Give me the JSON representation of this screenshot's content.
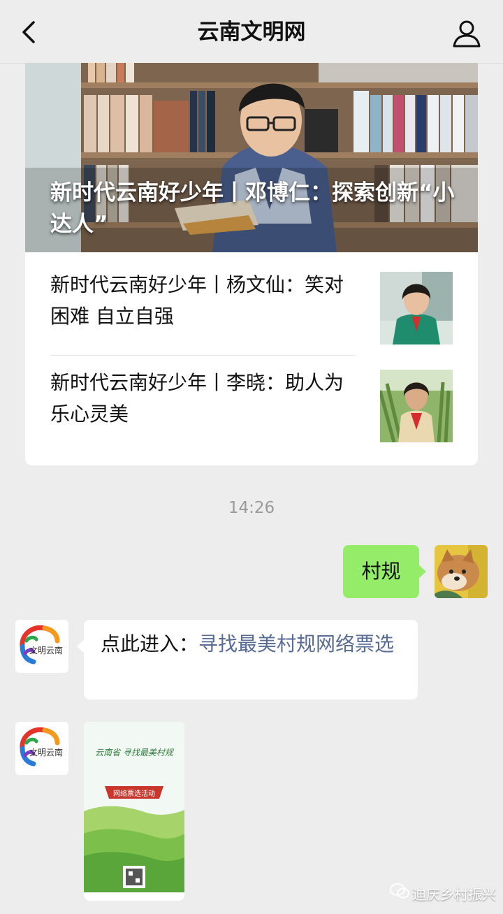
{
  "nav": {
    "title": "云南文明网",
    "back_icon": "chevron-left-icon",
    "profile_icon": "user-icon"
  },
  "article_card": {
    "main_title": "新时代云南好少年丨邓博仁：探索创新“小达人”",
    "sub_articles": [
      {
        "title": "新时代云南好少年丨杨文仙：笑对困难 自立自强"
      },
      {
        "title": "新时代云南好少年丨李晓：助人为乐心灵美"
      }
    ]
  },
  "chat": {
    "timestamp": "14:26",
    "my_message": "村规",
    "bot_message": {
      "prefix": "点此进入：",
      "link": "寻找最美村规网络票选"
    },
    "poster": {
      "headline": "云南省 寻找最美村规",
      "banner": "网络票选活动"
    }
  },
  "bot_avatar_text": "文明云南",
  "watermark": "迪庆乡村振兴",
  "colors": {
    "my_bubble": "#95ec69",
    "link": "#576b95",
    "background": "#ededed"
  }
}
